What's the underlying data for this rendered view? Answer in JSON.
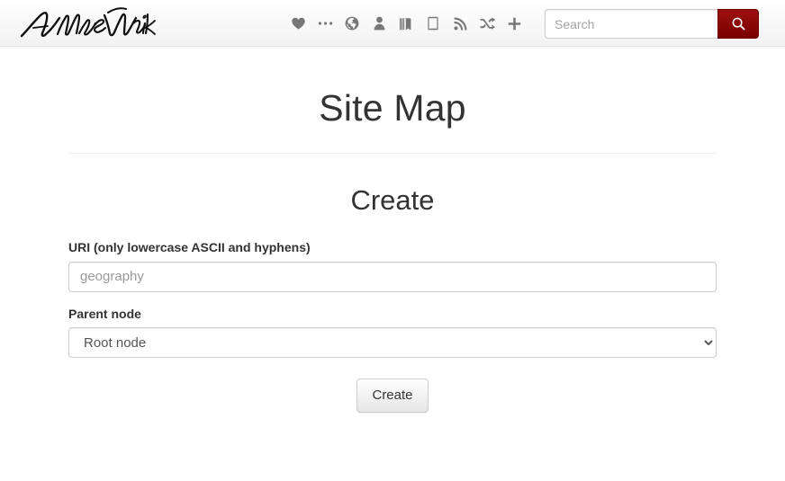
{
  "navbar": {
    "brand_text": "AMuseWiki",
    "icons": [
      {
        "name": "heart-icon",
        "title": "Favorites"
      },
      {
        "name": "ellipsis-icon",
        "title": "More"
      },
      {
        "name": "globe-icon",
        "title": "Language"
      },
      {
        "name": "user-icon",
        "title": "User"
      },
      {
        "name": "book-icon",
        "title": "Library"
      },
      {
        "name": "tablet-icon",
        "title": "Tablet"
      },
      {
        "name": "rss-icon",
        "title": "Feed"
      },
      {
        "name": "random-icon",
        "title": "Random"
      },
      {
        "name": "plus-icon",
        "title": "Add"
      }
    ],
    "search": {
      "placeholder": "Search",
      "value": "",
      "button_icon": "search-icon"
    }
  },
  "page": {
    "title": "Site Map",
    "section_title": "Create"
  },
  "form": {
    "uri": {
      "label": "URI (only lowercase ASCII and hyphens)",
      "placeholder": "geography",
      "value": ""
    },
    "parent": {
      "label": "Parent node",
      "selected": "Root node",
      "options": [
        "Root node"
      ]
    },
    "submit_label": "Create"
  },
  "colors": {
    "accent": "#8b0000",
    "text": "#333333",
    "muted": "#9a9a9a",
    "border": "#cccccc",
    "navbar_border": "#e3e3e3"
  }
}
